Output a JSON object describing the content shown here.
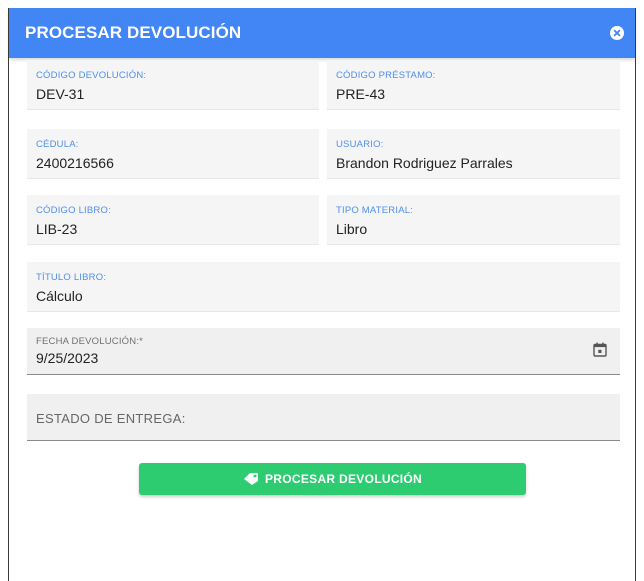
{
  "dialog": {
    "title": "PROCESAR DEVOLUCIÓN",
    "close_icon": "close-circle-icon"
  },
  "fields": {
    "codigo_devolucion": {
      "label": "CÓDIGO DEVOLUCIÓN:",
      "value": "DEV-31"
    },
    "codigo_prestamo": {
      "label": "CÓDIGO PRÉSTAMO:",
      "value": "PRE-43"
    },
    "cedula": {
      "label": "CÉDULA:",
      "value": "2400216566"
    },
    "usuario": {
      "label": "USUARIO:",
      "value": "Brandon Rodriguez Parrales"
    },
    "codigo_libro": {
      "label": "CÓDIGO LIBRO:",
      "value": "LIB-23"
    },
    "tipo_material": {
      "label": "TIPO MATERIAL:",
      "value": "Libro"
    },
    "titulo_libro": {
      "label": "TÍTULO LIBRO:",
      "value": "Cálculo"
    }
  },
  "fecha_devolucion": {
    "label": "FECHA DEVOLUCIÓN:*",
    "value": "9/25/2023",
    "icon": "calendar-icon"
  },
  "estado_entrega": {
    "label": "ESTADO DE ENTREGA:",
    "value": ""
  },
  "submit": {
    "label": "PROCESAR DEVOLUCIÓN",
    "icon": "tag-icon"
  },
  "colors": {
    "header": "#4285f4",
    "label_accent": "#4f8ff0",
    "button": "#2ecc71"
  }
}
